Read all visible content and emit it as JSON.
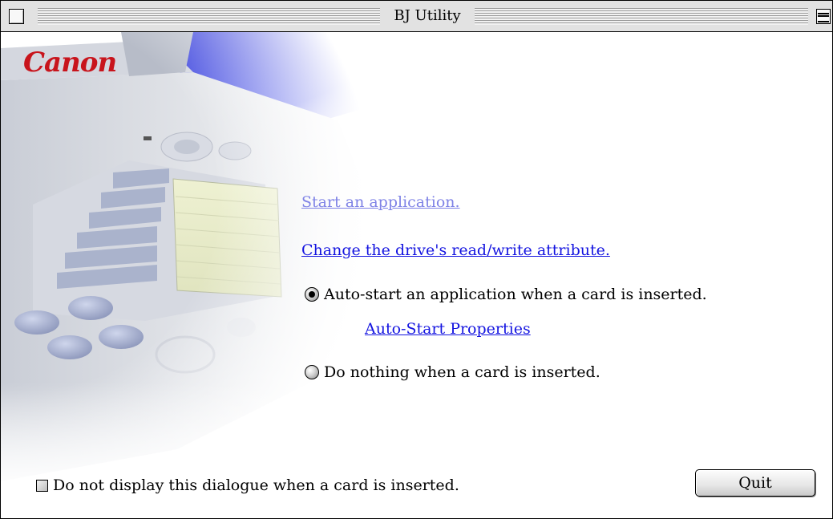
{
  "window": {
    "title": "BJ Utility"
  },
  "brand": {
    "logo_text": "Canon",
    "logo_color": "#c8141c"
  },
  "links": {
    "start_application": "Start an application.",
    "change_attribute": "Change the drive's read/write attribute.",
    "auto_start_properties": "Auto-Start Properties"
  },
  "options": {
    "auto_start_label": "Auto-start an application when a card is inserted.",
    "do_nothing_label": "Do nothing when a card is inserted.",
    "selected": "auto_start"
  },
  "footer": {
    "checkbox_label": "Do not display this dialogue when a card is inserted.",
    "checkbox_checked": false,
    "quit_label": "Quit"
  },
  "colors": {
    "link_visited": "#7f83e6",
    "link": "#1414e0"
  }
}
